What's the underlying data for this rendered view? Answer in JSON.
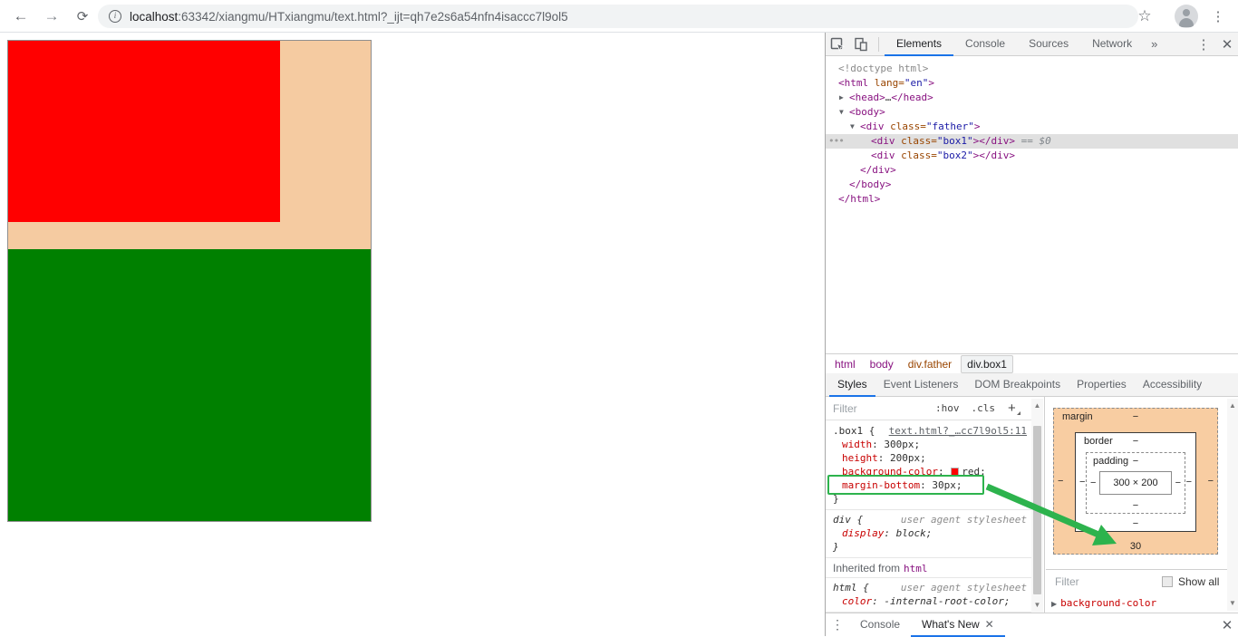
{
  "browser": {
    "url_host": "localhost",
    "url_rest": ":63342/xiangmu/HTxiangmu/text.html?_ijt=qh7e2s6a54nfn4isaccc7l9ol5"
  },
  "page": {
    "father_color": "#f5cba1",
    "box1_color": "#ff0000",
    "box2_color": "#008000"
  },
  "devtools": {
    "main_tabs": [
      {
        "label": "Elements",
        "active": true
      },
      {
        "label": "Console",
        "active": false
      },
      {
        "label": "Sources",
        "active": false
      },
      {
        "label": "Network",
        "active": false
      }
    ],
    "more_tabs": "»",
    "tree": [
      {
        "level": 0,
        "arrow": "",
        "segs": [
          {
            "t": "doctype",
            "s": "<!doctype html>"
          }
        ]
      },
      {
        "level": 0,
        "arrow": "",
        "segs": [
          {
            "t": "tag",
            "s": "<html"
          },
          {
            "t": "plain",
            "s": " "
          },
          {
            "t": "attr",
            "s": "lang="
          },
          {
            "t": "val",
            "s": "\"en\""
          },
          {
            "t": "tag",
            "s": ">"
          }
        ]
      },
      {
        "level": 1,
        "arrow": "▶",
        "segs": [
          {
            "t": "tag",
            "s": "<head>"
          },
          {
            "t": "plain",
            "s": "…"
          },
          {
            "t": "tag",
            "s": "</head>"
          }
        ]
      },
      {
        "level": 1,
        "arrow": "▼",
        "segs": [
          {
            "t": "tag",
            "s": "<body>"
          }
        ]
      },
      {
        "level": 2,
        "arrow": "▼",
        "segs": [
          {
            "t": "tag",
            "s": "<div"
          },
          {
            "t": "plain",
            "s": " "
          },
          {
            "t": "attr",
            "s": "class="
          },
          {
            "t": "val",
            "s": "\"father\""
          },
          {
            "t": "tag",
            "s": ">"
          }
        ]
      },
      {
        "level": 3,
        "arrow": "",
        "selected": true,
        "gutter": "•••",
        "segs": [
          {
            "t": "tag",
            "s": "<div"
          },
          {
            "t": "plain",
            "s": " "
          },
          {
            "t": "attr",
            "s": "class="
          },
          {
            "t": "val",
            "s": "\"box1\""
          },
          {
            "t": "tag",
            "s": "></div>"
          },
          {
            "t": "meta",
            "s": " == $0"
          }
        ]
      },
      {
        "level": 3,
        "arrow": "",
        "segs": [
          {
            "t": "tag",
            "s": "<div"
          },
          {
            "t": "plain",
            "s": " "
          },
          {
            "t": "attr",
            "s": "class="
          },
          {
            "t": "val",
            "s": "\"box2\""
          },
          {
            "t": "tag",
            "s": "></div>"
          }
        ]
      },
      {
        "level": 2,
        "arrow": "",
        "segs": [
          {
            "t": "tag",
            "s": "</div>"
          }
        ]
      },
      {
        "level": 1,
        "arrow": "",
        "segs": [
          {
            "t": "tag",
            "s": "</body>"
          }
        ]
      },
      {
        "level": 0,
        "arrow": "",
        "segs": [
          {
            "t": "tag",
            "s": "</html>"
          }
        ]
      }
    ],
    "breadcrumbs": [
      {
        "label": "html",
        "cls": "tag"
      },
      {
        "label": "body",
        "cls": "tag"
      },
      {
        "label": "div.father",
        "cls": "cls"
      },
      {
        "label": "div.box1",
        "cls": "sel"
      }
    ],
    "sidebar_tabs": [
      {
        "label": "Styles",
        "active": true
      },
      {
        "label": "Event Listeners",
        "active": false
      },
      {
        "label": "DOM Breakpoints",
        "active": false
      },
      {
        "label": "Properties",
        "active": false
      },
      {
        "label": "Accessibility",
        "active": false
      }
    ],
    "styles": {
      "filter_placeholder": "Filter",
      "pseudo_toggle": ":hov",
      "class_toggle": ".cls",
      "new_rule": "+",
      "blocks": [
        {
          "kind": "rule",
          "selector": ".box1",
          "link": "text.html?_…cc7l9ol5:11",
          "ua": false,
          "close": true,
          "props": [
            {
              "name": "width",
              "value": "300px"
            },
            {
              "name": "height",
              "value": "200px"
            },
            {
              "name": "background-color",
              "value": "red",
              "swatch": "#ff0000"
            },
            {
              "name": "margin-bottom",
              "value": "30px",
              "annotated": true
            }
          ]
        },
        {
          "kind": "rule",
          "selector": "div",
          "origin": "user agent stylesheet",
          "ua": true,
          "close": true,
          "props": [
            {
              "name": "display",
              "value": "block"
            }
          ]
        },
        {
          "kind": "inherited",
          "label": "Inherited from",
          "node": "html"
        },
        {
          "kind": "rule",
          "selector": "html",
          "origin": "user agent stylesheet",
          "ua": true,
          "close": false,
          "props": [
            {
              "name": "color",
              "value": "-internal-root-color"
            }
          ]
        }
      ]
    },
    "box_model": {
      "margin_label": "margin",
      "border_label": "border",
      "padding_label": "padding",
      "content": "300 × 200",
      "margin": {
        "top": "−",
        "left": "−",
        "right": "−",
        "bottom": "30"
      },
      "border": {
        "top": "−",
        "left": "−",
        "right": "−",
        "bottom": "−"
      },
      "padding": {
        "top": "−",
        "left": "−",
        "right": "−",
        "bottom": "−"
      }
    },
    "computed": {
      "filter_placeholder": "Filter",
      "show_all_label": "Show all",
      "first_property": "background-color"
    },
    "drawer_tabs": [
      {
        "label": "Console",
        "active": false,
        "closable": false
      },
      {
        "label": "What's New",
        "active": true,
        "closable": true
      }
    ]
  },
  "annotation": {
    "color": "#2db34d",
    "highlighted_declaration": "margin-bottom: 30px;",
    "points_to_value": "30"
  }
}
